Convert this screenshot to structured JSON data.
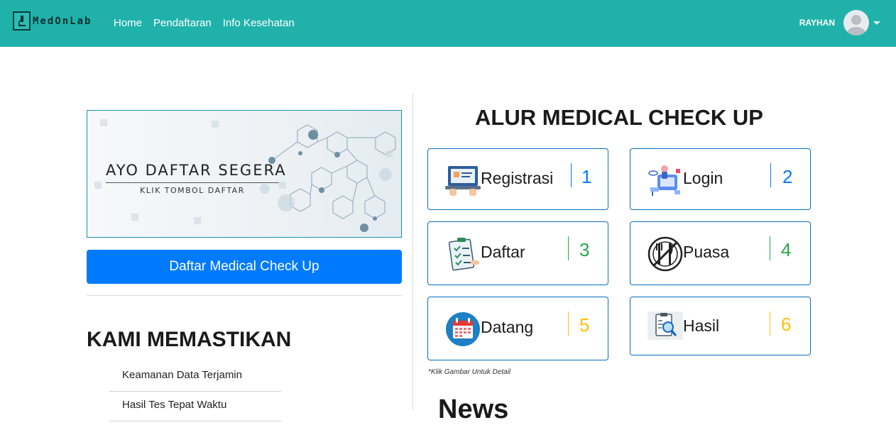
{
  "nav": {
    "brand": "MedOnLab",
    "links": [
      "Home",
      "Pendaftaran",
      "Info Kesehatan"
    ],
    "user_name": "RAYHAN"
  },
  "banner": {
    "title": "AYO DAFTAR SEGERA",
    "subtitle": "KLIK TOMBOL DAFTAR"
  },
  "cta_button": "Daftar Medical Check Up",
  "guarantee": {
    "heading": "KAMI MEMASTIKAN",
    "items": [
      "Keamanan Data Terjamin",
      "Hasil Tes Tepat Waktu"
    ]
  },
  "alur": {
    "heading": "ALUR MEDICAL CHECK UP",
    "steps": [
      {
        "label": "Registrasi",
        "number": "1",
        "color": "#007bff",
        "icon": "laptop-registration-icon"
      },
      {
        "label": "Login",
        "number": "2",
        "color": "#007bff",
        "icon": "login-illustration-icon"
      },
      {
        "label": "Daftar",
        "number": "3",
        "color": "#28a745",
        "icon": "clipboard-checklist-icon"
      },
      {
        "label": "Puasa",
        "number": "4",
        "color": "#28a745",
        "icon": "no-eating-icon"
      },
      {
        "label": "Datang",
        "number": "5",
        "color": "#ffc107",
        "icon": "calendar-icon"
      },
      {
        "label": "Hasil",
        "number": "6",
        "color": "#ffc107",
        "icon": "lab-result-search-icon"
      }
    ],
    "footnote": "*Klik Gambar Untuk Detail"
  },
  "news_heading": "News"
}
